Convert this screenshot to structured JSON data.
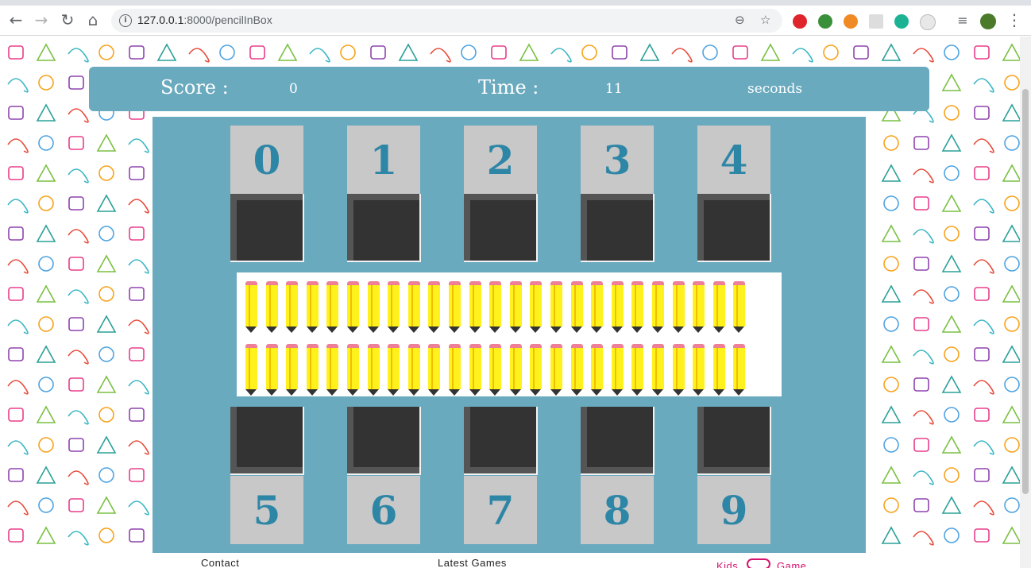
{
  "browser": {
    "url_host": "127.0.0.1",
    "url_rest": ":8000/pencilInBox"
  },
  "header": {
    "score_label": "Score :",
    "score_value": "0",
    "time_label": "Time :",
    "time_value": "11",
    "time_unit": "seconds"
  },
  "top_cards": [
    "0",
    "1",
    "2",
    "3",
    "4"
  ],
  "bottom_cards": [
    "5",
    "6",
    "7",
    "8",
    "9"
  ],
  "pencils": {
    "rows": 2,
    "per_row": 25
  },
  "footer": {
    "contact": "Contact",
    "latest_games": "Latest Games",
    "brand_kids": "Kids",
    "brand_game": "Game"
  },
  "colors": {
    "panel": "#6aaabf",
    "card": "#c8c8c8",
    "card_digit": "#2e86a6",
    "box": "#333333",
    "pencil": "#fff21c",
    "eraser": "#ef7f97",
    "brand": "#d6156e"
  }
}
